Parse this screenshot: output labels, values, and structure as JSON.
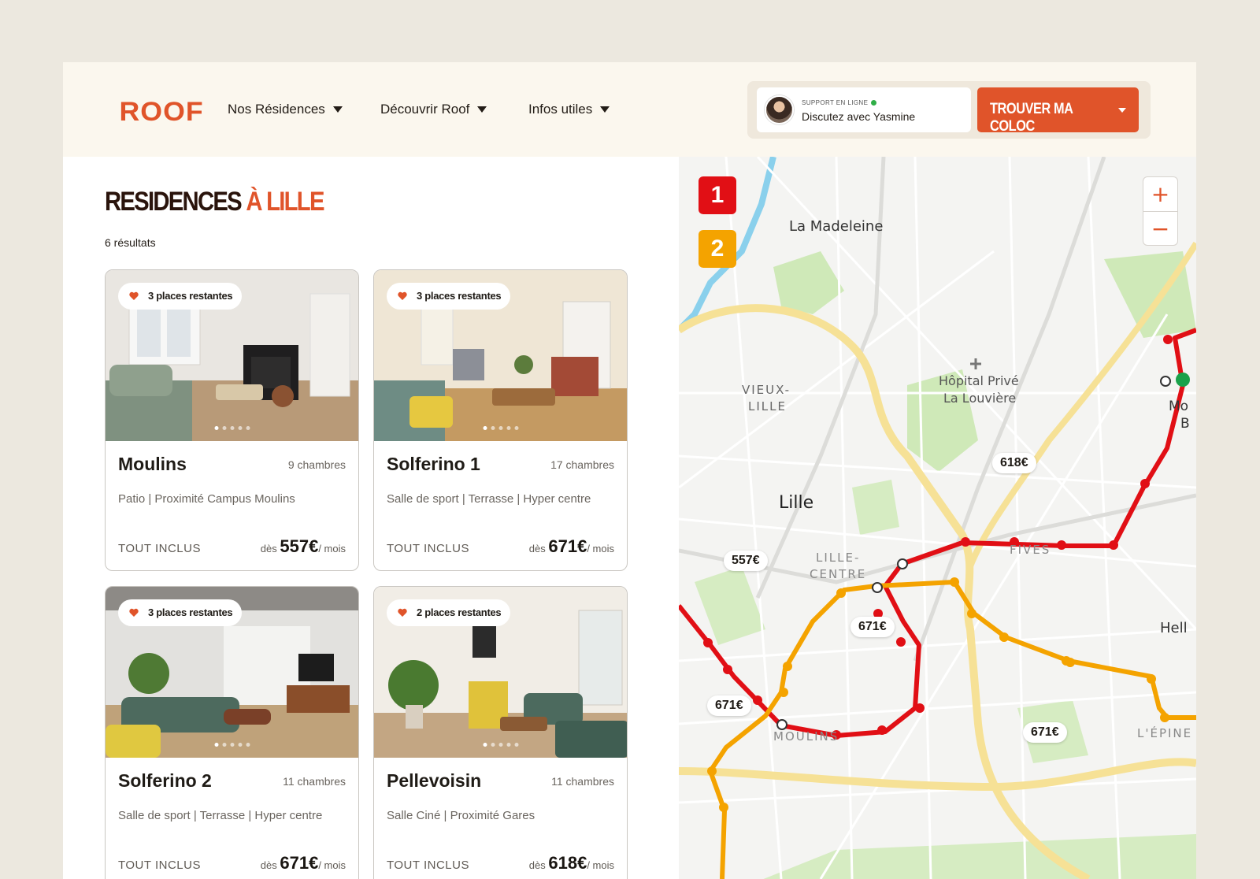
{
  "header": {
    "logo": "ROOF",
    "nav": [
      "Nos Résidences",
      "Découvrir Roof",
      "Infos utiles"
    ],
    "support_tag": "SUPPORT EN LIGNE",
    "support_text": "Discutez avec Yasmine",
    "cta": "TROUVER MA COLOC"
  },
  "page": {
    "title_a": "RESIDENCES",
    "title_b": "À LILLE",
    "results": "6 résultats"
  },
  "cards": [
    {
      "name": "Moulins",
      "rooms": "9 chambres",
      "tags": "Patio | Proximité Campus Moulins",
      "included": "TOUT INCLUS",
      "from": "dès",
      "price": "557€",
      "per": "/ mois",
      "badge": "3 places restantes"
    },
    {
      "name": "Solferino 1",
      "rooms": "17 chambres",
      "tags": "Salle de sport | Terrasse | Hyper centre",
      "included": "TOUT INCLUS",
      "from": "dès",
      "price": "671€",
      "per": "/ mois",
      "badge": "3 places restantes"
    },
    {
      "name": "Solferino 2",
      "rooms": "11 chambres",
      "tags": "Salle de sport | Terrasse | Hyper centre",
      "included": "TOUT INCLUS",
      "from": "dès",
      "price": "671€",
      "per": "/ mois",
      "badge": "3 places restantes"
    },
    {
      "name": "Pellevoisin",
      "rooms": "11 chambres",
      "tags": "Salle Ciné | Proximité Gares",
      "included": "TOUT INCLUS",
      "from": "dès",
      "price": "618€",
      "per": "/ mois",
      "badge": "2 places restantes"
    }
  ],
  "map": {
    "layers": [
      "1",
      "2"
    ],
    "zoom_in": "+",
    "zoom_out": "−",
    "places": {
      "madeleine": "La Madeleine",
      "vieux1": "VIEUX-",
      "vieux2": "LILLE",
      "hopital1": "Hôpital Privé",
      "hopital2": "La Louvière",
      "lille": "Lille",
      "centre1": "LILLE-",
      "centre2": "CENTRE",
      "fives": "FIVES",
      "moulins": "MOULINS",
      "hell": "Hell",
      "epine": "L'ÉPINE",
      "mb1": "Mo",
      "mb2": "B"
    },
    "prices": [
      "618€",
      "557€",
      "671€",
      "671€",
      "671€"
    ]
  },
  "colors": {
    "accent": "#e0542a",
    "metro_line_1": "#e10f15",
    "metro_line_2": "#f4a300",
    "online": "#2fae47"
  }
}
